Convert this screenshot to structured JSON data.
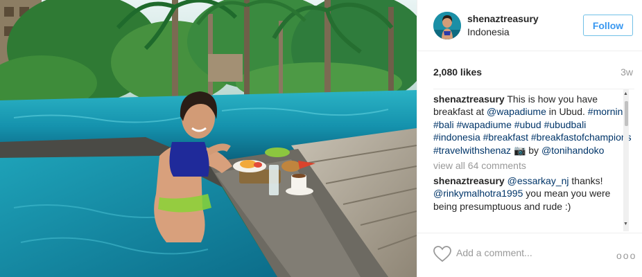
{
  "post": {
    "username": "shenaztreasury",
    "location": "Indonesia",
    "follow_label": "Follow",
    "likes": "2,080 likes",
    "age": "3w",
    "caption_user": "shenaztreasury",
    "caption_parts": [
      {
        "text": "This is how you have breakfast at ",
        "kind": "text"
      },
      {
        "text": "@wapadiume",
        "kind": "tag"
      },
      {
        "text": " in Ubud. ",
        "kind": "text"
      },
      {
        "text": "#morning",
        "kind": "tag"
      },
      {
        "text": " ",
        "kind": "text"
      },
      {
        "text": "#bali",
        "kind": "tag"
      },
      {
        "text": " ",
        "kind": "text"
      },
      {
        "text": "#wapadiume",
        "kind": "tag"
      },
      {
        "text": " ",
        "kind": "text"
      },
      {
        "text": "#ubud",
        "kind": "tag"
      },
      {
        "text": " ",
        "kind": "text"
      },
      {
        "text": "#ubudbali",
        "kind": "tag"
      },
      {
        "text": " ",
        "kind": "text"
      },
      {
        "text": "#indonesia",
        "kind": "tag"
      },
      {
        "text": " ",
        "kind": "text"
      },
      {
        "text": "#breakfast",
        "kind": "tag"
      },
      {
        "text": " ",
        "kind": "text"
      },
      {
        "text": "#breakfastofchampions",
        "kind": "tag"
      },
      {
        "text": " ",
        "kind": "text"
      },
      {
        "text": "#travelwithshenaz",
        "kind": "tag"
      },
      {
        "text": " 📷 by ",
        "kind": "text"
      },
      {
        "text": "@tonihandoko",
        "kind": "tag"
      }
    ],
    "view_all": "view all 64 comments",
    "comment_user": "shenaztreasury",
    "comment_parts": [
      {
        "text": "@essarkay_nj",
        "kind": "tag"
      },
      {
        "text": " thanks! ",
        "kind": "text"
      },
      {
        "text": "@rinkymalhotra1995",
        "kind": "tag"
      },
      {
        "text": " you mean you were being presumptuous and rude :)",
        "kind": "text"
      }
    ],
    "add_comment_placeholder": "Add a comment...",
    "more_label": "ooo"
  },
  "icons": {
    "heart": "heart-outline-icon",
    "more": "more-options-icon",
    "camera": "camera-emoji"
  },
  "colors": {
    "follow_text": "#3897f0",
    "follow_border": "#70c0e7",
    "tag": "#003569",
    "muted": "#999999"
  }
}
